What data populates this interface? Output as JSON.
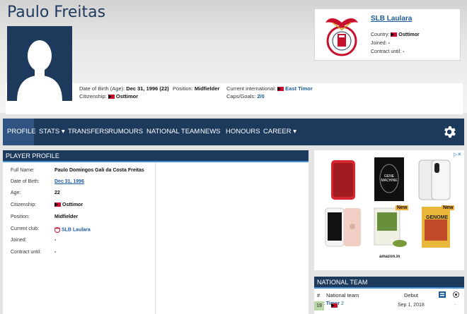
{
  "header": {
    "player_name": "Paulo Freitas",
    "dob_label": "Date of Birth (Age):",
    "dob_value": "Dec 31, 1996 (22)",
    "citizenship_label": "Citizenship:",
    "citizenship_value": "Osttimor",
    "position_label": "Position:",
    "position_value": "Midfielder",
    "international_label": "Current international:",
    "international_value": "East Timor",
    "caps_label": "Caps/Goals:",
    "caps_value": "2/0"
  },
  "club": {
    "name": "SLB Laulara",
    "country_label": "Country:",
    "country_value": "Osttimor",
    "joined_label": "Joined:",
    "joined_value": "-",
    "contract_label": "Contract until:",
    "contract_value": "-"
  },
  "nav": {
    "items": [
      "PROFILE",
      "STATS ▾",
      "TRANSFERS",
      "RUMOURS",
      "NATIONAL TEAM",
      "NEWS",
      "HONOURS",
      "CAREER ▾"
    ],
    "settings_icon": "gear-icon"
  },
  "profile": {
    "title": "PLAYER PROFILE",
    "rows": [
      {
        "label": "Full Name:",
        "value": "Paulo Domingos Gali da Costa Freitas"
      },
      {
        "label": "Date of Birth:",
        "value": "Dec 31, 1996"
      },
      {
        "label": "Age:",
        "value": "22"
      },
      {
        "label": "Citizenship:",
        "value": "Osttimor"
      },
      {
        "label": "Position:",
        "value": "Midfielder"
      },
      {
        "label": "Current club:",
        "value": "SLB Laulara"
      },
      {
        "label": "Joined:",
        "value": "-"
      },
      {
        "label": "Contract until:",
        "value": "-"
      }
    ]
  },
  "ad": {
    "badges": [
      "New",
      "New"
    ],
    "book1_text": "GENE MACHINE",
    "book2_text": "GENOME",
    "brand": "amazon.in"
  },
  "national_team": {
    "title": "NATIONAL TEAM",
    "headers": {
      "num": "#",
      "team": "National team",
      "debut": "Debut"
    },
    "rows": [
      {
        "num": "19",
        "team": "East Timor",
        "debut": "Sep 1, 2018",
        "caps": "2",
        "goals": "-"
      }
    ]
  },
  "colors": {
    "navy": "#1d3a5c",
    "link": "#1d5a99",
    "accent": "#4a8fd4"
  }
}
